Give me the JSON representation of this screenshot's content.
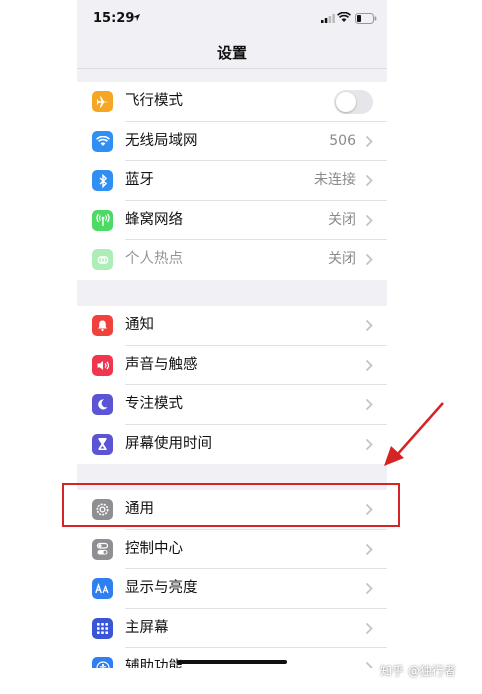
{
  "status_bar": {
    "time": "15:29",
    "location_icon": "location-arrow-icon",
    "signal_icon": "cellular-signal-icon",
    "wifi_icon": "wifi-icon",
    "battery_icon": "battery-icon"
  },
  "nav": {
    "title": "设置"
  },
  "groups": [
    {
      "items": [
        {
          "label": "飞行模式",
          "icon": "airplane-icon",
          "color": "#f5a623",
          "control": "toggle",
          "toggle_on": false
        },
        {
          "label": "无线局域网",
          "icon": "wifi-icon",
          "color": "#2f8ff3",
          "value": "506"
        },
        {
          "label": "蓝牙",
          "icon": "bluetooth-icon",
          "color": "#2f8ff3",
          "value": "未连接"
        },
        {
          "label": "蜂窝网络",
          "icon": "cellular-antenna-icon",
          "color": "#4cd964",
          "value": "关闭"
        },
        {
          "label": "个人热点",
          "icon": "hotspot-icon",
          "color": "#4cd964",
          "value": "关闭",
          "dimmed": true
        }
      ]
    },
    {
      "items": [
        {
          "label": "通知",
          "icon": "notification-bell-icon",
          "color": "#f0413c"
        },
        {
          "label": "声音与触感",
          "icon": "speaker-icon",
          "color": "#f0364f"
        },
        {
          "label": "专注模式",
          "icon": "moon-icon",
          "color": "#5b55d6"
        },
        {
          "label": "屏幕使用时间",
          "icon": "hourglass-icon",
          "color": "#5b55d6"
        }
      ]
    },
    {
      "items": [
        {
          "label": "通用",
          "icon": "gear-icon",
          "color": "#8e8e93"
        },
        {
          "label": "控制中心",
          "icon": "toggles-icon",
          "color": "#8e8e93"
        },
        {
          "label": "显示与亮度",
          "icon": "text-size-icon",
          "color": "#2f7ff0"
        },
        {
          "label": "主屏幕",
          "icon": "home-grid-icon",
          "color": "#3a55d6"
        },
        {
          "label": "辅助功能",
          "icon": "accessibility-icon",
          "color": "#2f7ff0"
        }
      ]
    }
  ],
  "annotation": {
    "highlight_color": "#d52424"
  },
  "watermark": "知乎 @独行者"
}
